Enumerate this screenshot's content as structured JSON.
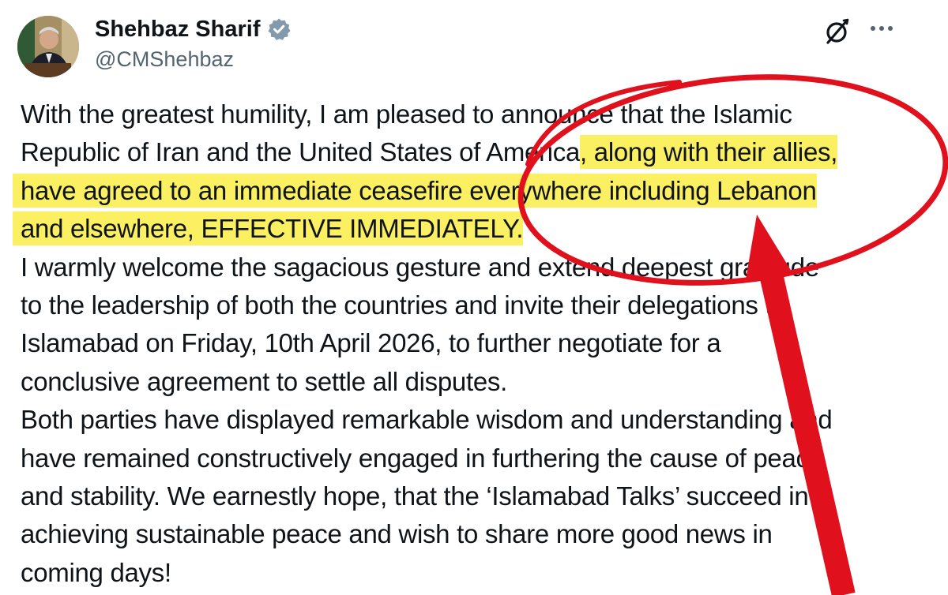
{
  "author": {
    "name": "Shehbaz Sharif",
    "handle": "@CMShehbaz",
    "verified_icon": "verified-badge-icon",
    "badge_color": "#829aab"
  },
  "actions": {
    "grok_icon": "grok-icon",
    "more_icon": "more-options-icon"
  },
  "tweet": {
    "p1": {
      "l1": "With the greatest humility, I am pleased to announce that the Islamic",
      "l2a": "Republic of Iran and the United States of America",
      "l2b": ", along with their allies,",
      "l3": "have agreed to an immediate ceasefire everywhere including Lebanon",
      "l4": "and elsewhere, EFFECTIVE IMMEDIATELY."
    },
    "p2": {
      "l1": "I warmly welcome the sagacious gesture and extend deepest gratitude",
      "l2": "to the leadership of both the countries and invite their delegations to",
      "l3": "Islamabad on Friday, 10th April 2026, to further negotiate for a",
      "l4": "conclusive agreement to settle all disputes."
    },
    "p3": {
      "l1": "Both parties have displayed remarkable wisdom and understanding and",
      "l2": "have remained constructively engaged in furthering the cause of peace",
      "l3": "and stability. We earnestly hope, that the ‘Islamabad Talks’ succeed in",
      "l4": "achieving sustainable peace and wish to share more good news in",
      "l5": "coming days!"
    }
  },
  "colors": {
    "highlight": "#fbef62",
    "annotation_red": "#e0101c",
    "text": "#0f1419",
    "secondary_text": "#536471"
  }
}
